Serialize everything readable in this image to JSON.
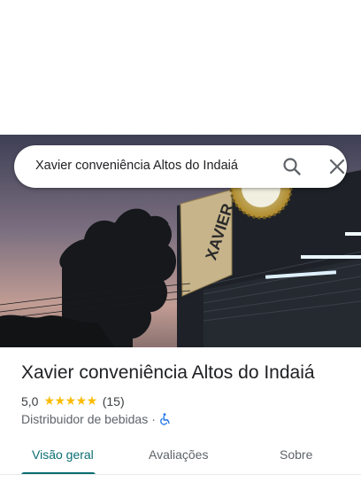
{
  "search": {
    "query": "Xavier conveniência Altos do Indaiá"
  },
  "hero": {
    "sign_text": "XAVIER"
  },
  "place": {
    "name": "Xavier conveniência Altos do Indaiá",
    "rating": "5,0",
    "stars": "★★★★★",
    "review_count": "(15)",
    "category": "Distribuidor de bebidas",
    "separator": "·"
  },
  "tabs": [
    {
      "label": "Visão geral",
      "active": true
    },
    {
      "label": "Avaliações",
      "active": false
    },
    {
      "label": "Sobre",
      "active": false
    }
  ],
  "colors": {
    "accent": "#0b6e72",
    "star": "#fbbc04",
    "accessibility": "#1a73e8"
  }
}
